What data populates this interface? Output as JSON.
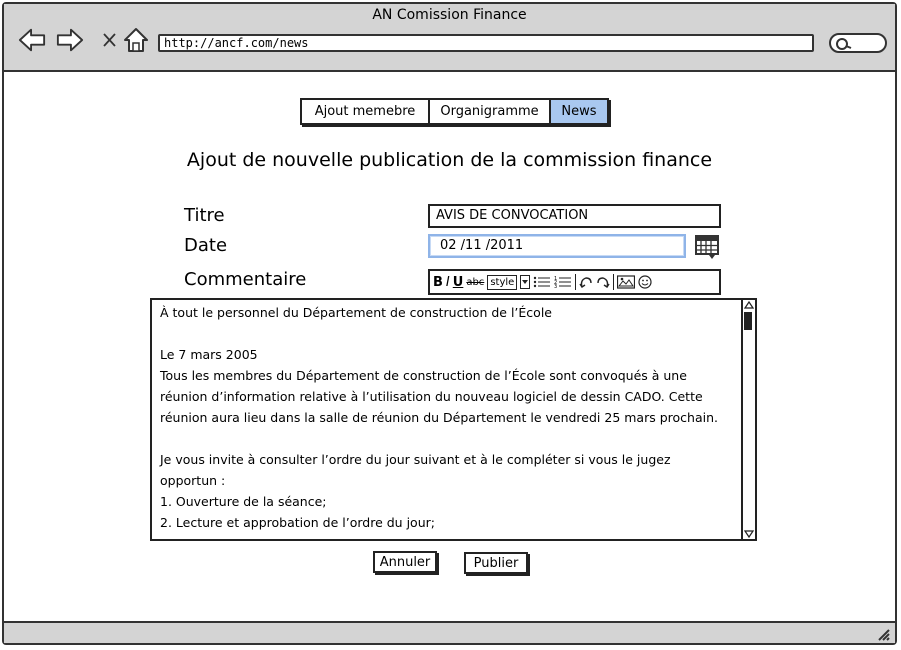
{
  "window": {
    "title": "AN Comission Finance",
    "url": "http://ancf.com/news"
  },
  "nav": {
    "back_icon": "back-arrow-icon",
    "forward_icon": "forward-arrow-icon",
    "stop_icon": "close-icon",
    "home_icon": "home-icon",
    "search_icon": "search-icon"
  },
  "tabs": [
    {
      "label": "Ajout memebre",
      "active": false
    },
    {
      "label": "Organigramme",
      "active": false
    },
    {
      "label": "News",
      "active": true
    }
  ],
  "form": {
    "heading": "Ajout de nouvelle publication de la commission finance",
    "titre_label": "Titre",
    "titre_value": "AVIS DE CONVOCATION",
    "date_label": "Date",
    "date_value": "02 /11 /2011",
    "commentaire_label": "Commentaire",
    "toolbar": {
      "bold": "B",
      "italic": "I",
      "underline": "U",
      "strike": "abc",
      "style": "style"
    },
    "comment_lines": [
      "À tout le personnel du Département de construction de l’École",
      "",
      "Le 7 mars 2005",
      "Tous les membres du Département de construction de l’École sont convoqués à une",
      "réunion d’information relative à l’utilisation du nouveau logiciel de dessin CADO. Cette",
      "réunion aura lieu dans la salle de réunion du Département le vendredi 25 mars prochain.",
      "",
      "Je vous invite à consulter l’ordre du jour suivant et à le compléter si vous le jugez",
      "opportun :",
      "1. Ouverture de la séance;",
      "2. Lecture et approbation de l’ordre du jour;"
    ]
  },
  "actions": {
    "cancel_label": "Annuler",
    "publish_label": "Publier"
  },
  "colors": {
    "chrome": "#d4d4d4",
    "active_tab": "#a9c8f0",
    "focus_border": "#8fb4e8"
  }
}
